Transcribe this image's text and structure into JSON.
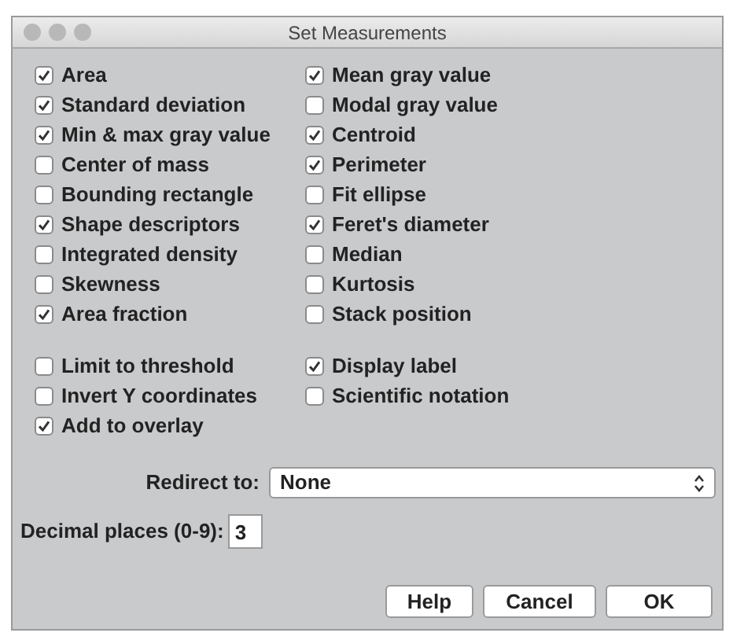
{
  "window": {
    "title": "Set Measurements"
  },
  "measurements": [
    {
      "label": "Area",
      "checked": true
    },
    {
      "label": "Mean gray value",
      "checked": true
    },
    {
      "label": "Standard deviation",
      "checked": true
    },
    {
      "label": "Modal gray value",
      "checked": false
    },
    {
      "label": "Min & max gray value",
      "checked": true
    },
    {
      "label": "Centroid",
      "checked": true
    },
    {
      "label": "Center of mass",
      "checked": false
    },
    {
      "label": "Perimeter",
      "checked": true
    },
    {
      "label": "Bounding rectangle",
      "checked": false
    },
    {
      "label": "Fit ellipse",
      "checked": false
    },
    {
      "label": "Shape descriptors",
      "checked": true
    },
    {
      "label": "Feret's diameter",
      "checked": true
    },
    {
      "label": "Integrated density",
      "checked": false
    },
    {
      "label": "Median",
      "checked": false
    },
    {
      "label": "Skewness",
      "checked": false
    },
    {
      "label": "Kurtosis",
      "checked": false
    },
    {
      "label": "Area fraction",
      "checked": true
    },
    {
      "label": "Stack position",
      "checked": false
    }
  ],
  "options": [
    {
      "label": "Limit to threshold",
      "checked": false
    },
    {
      "label": "Display label",
      "checked": true
    },
    {
      "label": "Invert Y coordinates",
      "checked": false
    },
    {
      "label": "Scientific notation",
      "checked": false
    },
    {
      "label": "Add to overlay",
      "checked": true
    }
  ],
  "redirect": {
    "label": "Redirect to:",
    "value": "None"
  },
  "decimal": {
    "label": "Decimal places (0-9):",
    "value": "3"
  },
  "buttons": [
    "Help",
    "Cancel",
    "OK"
  ]
}
